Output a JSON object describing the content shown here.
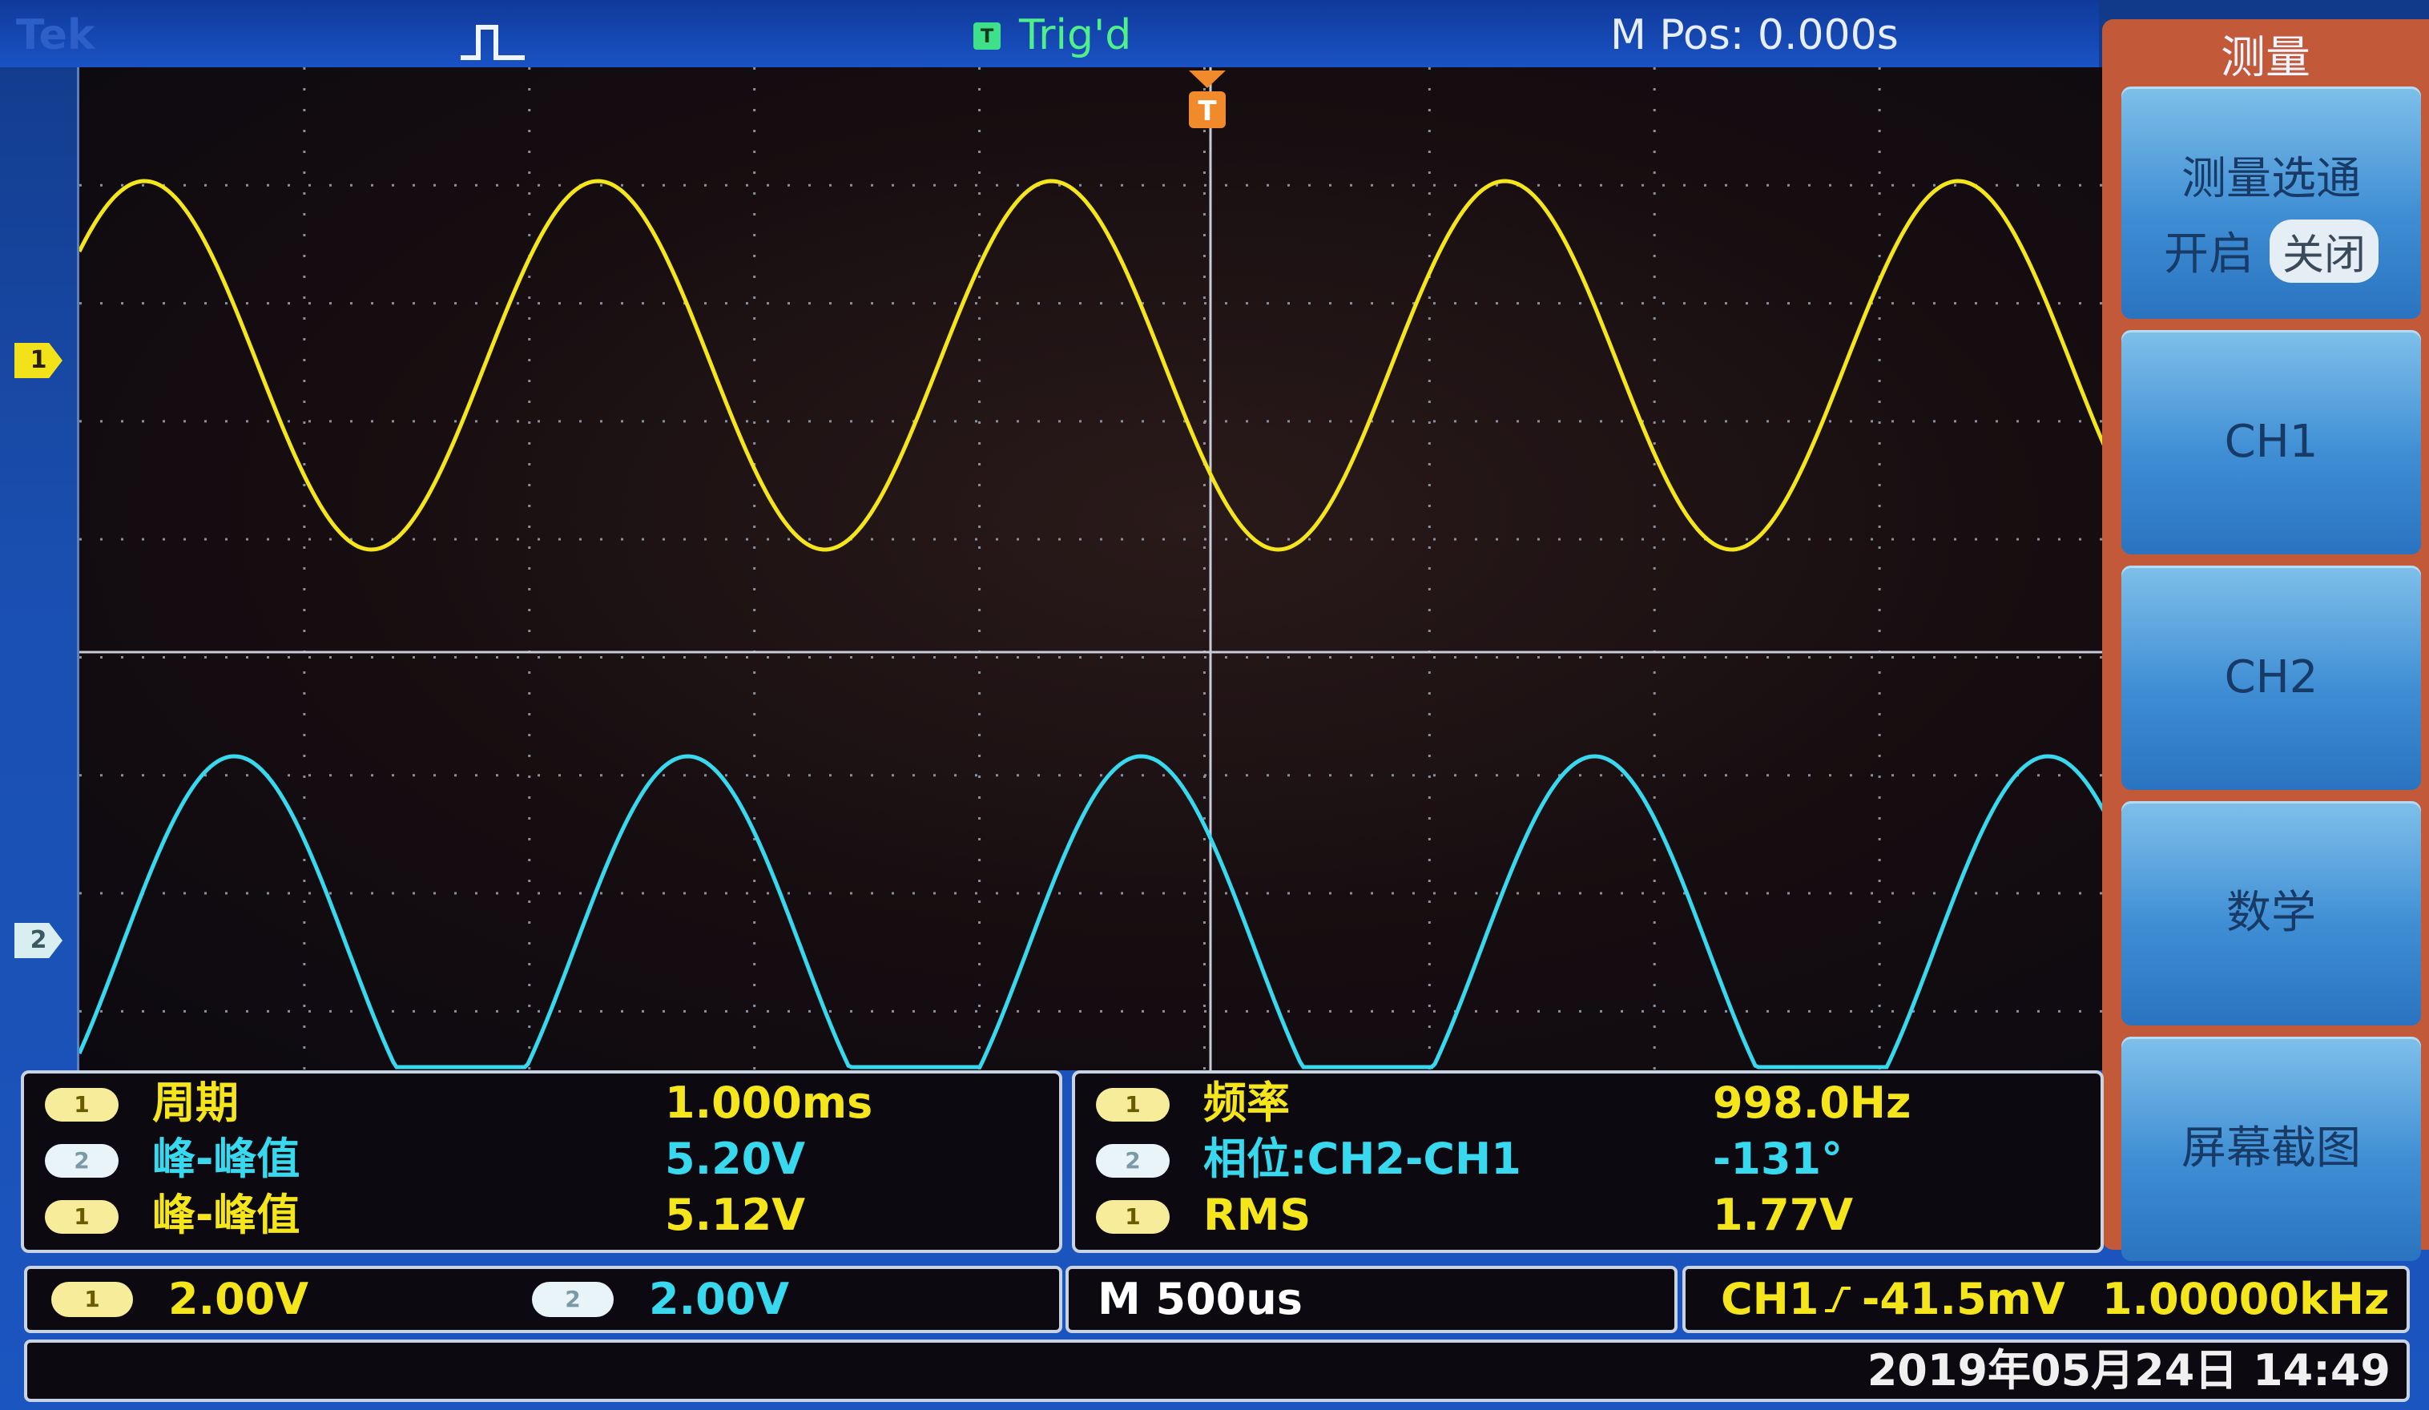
{
  "topbar": {
    "brand": "Tek",
    "trigger_state": "Trig'd",
    "trigger_state_badge": "T",
    "horizontal_position": "M Pos: 0.000s"
  },
  "channel_markers": {
    "ch1": "1",
    "ch2": "2"
  },
  "menu": {
    "title": "测量",
    "gating": {
      "label": "测量选通",
      "on": "开启",
      "off": "关闭",
      "selected": "关闭"
    },
    "ch1": "CH1",
    "ch2": "CH2",
    "math": "数学",
    "screenshot": "屏幕截图"
  },
  "measurements": {
    "left": [
      {
        "badge": "1",
        "name": "周期",
        "value": "1.000ms"
      },
      {
        "badge": "2",
        "name": "峰-峰值",
        "value": "5.20V"
      },
      {
        "badge": "1",
        "name": "峰-峰值",
        "value": "5.12V"
      }
    ],
    "right": [
      {
        "badge": "1",
        "name": "频率",
        "value": "998.0Hz"
      },
      {
        "badge": "2",
        "name": "相位:CH2-CH1",
        "value": "-131°"
      },
      {
        "badge": "1",
        "name": "RMS",
        "value": "1.77V"
      }
    ]
  },
  "status": {
    "ch1_badge": "1",
    "ch1_scale": "2.00V",
    "ch2_badge": "2",
    "ch2_scale": "2.00V",
    "timebase": "M 500us",
    "trigger_source": "CH1",
    "trigger_level": "-41.5mV",
    "trigger_frequency": "1.00000kHz",
    "datetime": "2019年05月24日 14:49"
  },
  "colors": {
    "ch1": "#f4e61a",
    "ch2": "#38d8ee",
    "trigger": "#f08a2a",
    "frame": "#1b55bf"
  },
  "icons": {
    "acquisition": "pulse-icon",
    "trigger_slope": "rising-edge-icon",
    "trigger_position": "trigger-position-icon"
  },
  "waveforms": {
    "ch1": {
      "period_ms": 1.0,
      "peak_to_peak_v": 5.12
    },
    "ch2": {
      "period_ms": 1.0,
      "peak_to_peak_v": 5.2,
      "phase_deg": -131
    }
  }
}
